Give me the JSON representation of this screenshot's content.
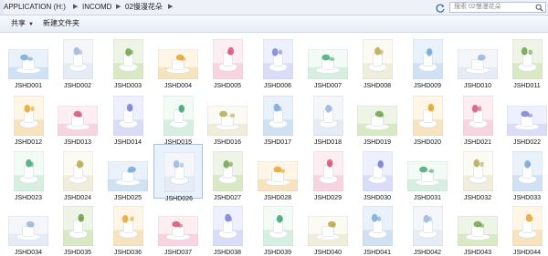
{
  "address_bar": {
    "crumbs": [
      "APPLICATION (H:)",
      "INCOMD",
      "02慢漫花朵"
    ],
    "search_placeholder": "搜索 02慢漫花朵"
  },
  "toolbar": {
    "share_label": "共享",
    "share_arrow": "▼",
    "new_folder_label": "新建文件夹"
  },
  "files": [
    {
      "name": "JSHD001"
    },
    {
      "name": "JSHD002"
    },
    {
      "name": "JSHD003"
    },
    {
      "name": "JSHD004"
    },
    {
      "name": "JSHD005"
    },
    {
      "name": "JSHD006"
    },
    {
      "name": "JSHD007"
    },
    {
      "name": "JSHD008"
    },
    {
      "name": "JSHD009"
    },
    {
      "name": "JSHD010"
    },
    {
      "name": "JSHD011"
    },
    {
      "name": "JSHD012"
    },
    {
      "name": "JSHD013"
    },
    {
      "name": "JSHD014"
    },
    {
      "name": "JSHD015"
    },
    {
      "name": "JSHD016"
    },
    {
      "name": "JSHD017"
    },
    {
      "name": "JSHD018"
    },
    {
      "name": "JSHD019"
    },
    {
      "name": "JSHD020"
    },
    {
      "name": "JSHD021"
    },
    {
      "name": "JSHD022"
    },
    {
      "name": "JSHD023"
    },
    {
      "name": "JSHD024"
    },
    {
      "name": "JSHD025"
    },
    {
      "name": "JSHD026",
      "selected": true
    },
    {
      "name": "JSHD027"
    },
    {
      "name": "JSHD028"
    },
    {
      "name": "JSHD029"
    },
    {
      "name": "JSHD030"
    },
    {
      "name": "JSHD031"
    },
    {
      "name": "JSHD032"
    },
    {
      "name": "JSHD033"
    },
    {
      "name": "JSHD034"
    },
    {
      "name": "JSHD035"
    },
    {
      "name": "JSHD036"
    },
    {
      "name": "JSHD037"
    },
    {
      "name": "JSHD038"
    },
    {
      "name": "JSHD039"
    },
    {
      "name": "JSHD040"
    },
    {
      "name": "JSHD041"
    },
    {
      "name": "JSHD042"
    },
    {
      "name": "JSHD043"
    },
    {
      "name": "JSHD044"
    }
  ]
}
